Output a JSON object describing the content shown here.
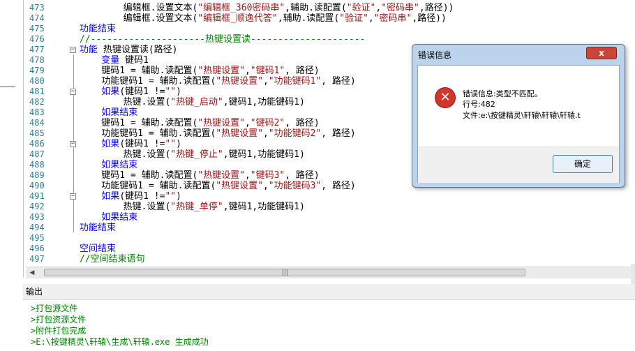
{
  "editor": {
    "lines": [
      {
        "no": "473",
        "code": [
          {
            "t": "        编辑框.设置文本(",
            "c": ""
          },
          {
            "t": "\"编辑框_360密码串\"",
            "c": "str"
          },
          {
            "t": ",辅助.读配置(",
            "c": ""
          },
          {
            "t": "\"验证\"",
            "c": "str"
          },
          {
            "t": ",",
            "c": ""
          },
          {
            "t": "\"密码串\"",
            "c": "str"
          },
          {
            "t": ",路径))",
            "c": ""
          }
        ]
      },
      {
        "no": "474",
        "code": [
          {
            "t": "        编辑框.设置文本(",
            "c": ""
          },
          {
            "t": "\"编辑框_顺逸代答\"",
            "c": "str"
          },
          {
            "t": ",辅助.读配置(",
            "c": ""
          },
          {
            "t": "\"验证\"",
            "c": "str"
          },
          {
            "t": ",",
            "c": ""
          },
          {
            "t": "\"密码串\"",
            "c": "str"
          },
          {
            "t": ",路径))",
            "c": ""
          }
        ]
      },
      {
        "no": "475",
        "code": [
          {
            "t": "功能结束",
            "c": "kw"
          }
        ]
      },
      {
        "no": "476",
        "code": [
          {
            "t": "//---------------------热键设置读---------------------",
            "c": "cm"
          }
        ]
      },
      {
        "no": "477",
        "code": [
          {
            "t": "功能",
            "c": "kw"
          },
          {
            "t": " 热键设置读(路径)",
            "c": ""
          }
        ]
      },
      {
        "no": "478",
        "code": [
          {
            "t": "    变量",
            "c": "kw"
          },
          {
            "t": " 键码1",
            "c": ""
          }
        ]
      },
      {
        "no": "479",
        "code": [
          {
            "t": "    键码1 = 辅助.读配置(",
            "c": ""
          },
          {
            "t": "\"热键设置\"",
            "c": "str"
          },
          {
            "t": ",",
            "c": ""
          },
          {
            "t": "\"键码1\"",
            "c": "str"
          },
          {
            "t": ", 路径)",
            "c": ""
          }
        ]
      },
      {
        "no": "480",
        "code": [
          {
            "t": "    功能键码1 = 辅助.读配置(",
            "c": ""
          },
          {
            "t": "\"热键设置\"",
            "c": "str"
          },
          {
            "t": ",",
            "c": ""
          },
          {
            "t": "\"功能键码1\"",
            "c": "str"
          },
          {
            "t": ", 路径)",
            "c": ""
          }
        ]
      },
      {
        "no": "481",
        "code": [
          {
            "t": "    如果",
            "c": "kw"
          },
          {
            "t": "(键码1 !=",
            "c": ""
          },
          {
            "t": "\"\"",
            "c": "str"
          },
          {
            "t": ")",
            "c": ""
          }
        ]
      },
      {
        "no": "482",
        "code": [
          {
            "t": "        热键.设置(",
            "c": ""
          },
          {
            "t": "\"热键_启动\"",
            "c": "str"
          },
          {
            "t": ",键码1,功能键码1)",
            "c": ""
          }
        ]
      },
      {
        "no": "483",
        "code": [
          {
            "t": "    如果结束",
            "c": "kw"
          }
        ]
      },
      {
        "no": "484",
        "code": [
          {
            "t": "    键码1 = 辅助.读配置(",
            "c": ""
          },
          {
            "t": "\"热键设置\"",
            "c": "str"
          },
          {
            "t": ",",
            "c": ""
          },
          {
            "t": "\"键码2\"",
            "c": "str"
          },
          {
            "t": ", 路径)",
            "c": ""
          }
        ]
      },
      {
        "no": "485",
        "code": [
          {
            "t": "    功能键码1 = 辅助.读配置(",
            "c": ""
          },
          {
            "t": "\"热键设置\"",
            "c": "str"
          },
          {
            "t": ",",
            "c": ""
          },
          {
            "t": "\"功能键码2\"",
            "c": "str"
          },
          {
            "t": ", 路径)",
            "c": ""
          }
        ]
      },
      {
        "no": "486",
        "code": [
          {
            "t": "    如果",
            "c": "kw"
          },
          {
            "t": "(键码1 !=",
            "c": ""
          },
          {
            "t": "\"\"",
            "c": "str"
          },
          {
            "t": ")",
            "c": ""
          }
        ]
      },
      {
        "no": "487",
        "code": [
          {
            "t": "        热键.设置(",
            "c": ""
          },
          {
            "t": "\"热键_停止\"",
            "c": "str"
          },
          {
            "t": ",键码1,功能键码1)",
            "c": ""
          }
        ]
      },
      {
        "no": "488",
        "code": [
          {
            "t": "    如果结束",
            "c": "kw"
          }
        ]
      },
      {
        "no": "489",
        "code": [
          {
            "t": "    键码1 = 辅助.读配置(",
            "c": ""
          },
          {
            "t": "\"热键设置\"",
            "c": "str"
          },
          {
            "t": ",",
            "c": ""
          },
          {
            "t": "\"键码3\"",
            "c": "str"
          },
          {
            "t": ", 路径)",
            "c": ""
          }
        ]
      },
      {
        "no": "490",
        "code": [
          {
            "t": "    功能键码1 = 辅助.读配置(",
            "c": ""
          },
          {
            "t": "\"热键设置\"",
            "c": "str"
          },
          {
            "t": ",",
            "c": ""
          },
          {
            "t": "\"功能键码3\"",
            "c": "str"
          },
          {
            "t": ", 路径)",
            "c": ""
          }
        ]
      },
      {
        "no": "491",
        "code": [
          {
            "t": "    如果",
            "c": "kw"
          },
          {
            "t": "(键码1 !=",
            "c": ""
          },
          {
            "t": "\"\"",
            "c": "str"
          },
          {
            "t": ")",
            "c": ""
          }
        ]
      },
      {
        "no": "492",
        "code": [
          {
            "t": "        热键.设置(",
            "c": ""
          },
          {
            "t": "\"热键_单停\"",
            "c": "str"
          },
          {
            "t": ",键码1,功能键码1)",
            "c": ""
          }
        ]
      },
      {
        "no": "493",
        "code": [
          {
            "t": "    如果结束",
            "c": "kw"
          }
        ]
      },
      {
        "no": "494",
        "code": [
          {
            "t": "功能结束",
            "c": "kw"
          }
        ]
      },
      {
        "no": "495",
        "code": []
      },
      {
        "no": "496",
        "code": [
          {
            "t": "空间结束",
            "c": "kw"
          }
        ]
      },
      {
        "no": "497",
        "code": [
          {
            "t": "//空间结束语句",
            "c": "cm"
          }
        ]
      }
    ],
    "scroll_grip": "|||"
  },
  "output": {
    "title": "输出",
    "lines": [
      ">打包源文件",
      ">打包资源文件",
      ">附件打包完成",
      ">E:\\按键精灵\\轩辕\\生成\\轩辕.exe 生成成功"
    ]
  },
  "dialog": {
    "title": "错误信息",
    "close_label": "x",
    "message": "错误信息:类型不匹配。",
    "line_info": "行号:482",
    "file_info": "文件:e:\\按键精灵\\轩辕\\轩辕\\轩辕.t",
    "ok_label": "确定",
    "icon_glyph": "✕"
  }
}
